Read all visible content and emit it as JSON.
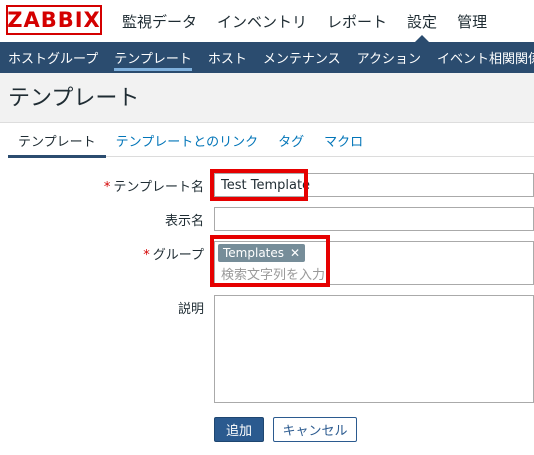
{
  "app": {
    "logo": "ZABBIX"
  },
  "topmenu": [
    "監視データ",
    "インベントリ",
    "レポート",
    "設定",
    "管理"
  ],
  "subnav": [
    "ホストグループ",
    "テンプレート",
    "ホスト",
    "メンテナンス",
    "アクション",
    "イベント相関関係"
  ],
  "page": {
    "title": "テンプレート"
  },
  "tabs": [
    "テンプレート",
    "テンプレートとのリンク",
    "タグ",
    "マクロ"
  ],
  "form": {
    "required_mark": "*",
    "template_name": {
      "label": "テンプレート名",
      "value": "Test Template"
    },
    "visible_name": {
      "label": "表示名",
      "value": ""
    },
    "groups": {
      "label": "グループ",
      "chip": "Templates",
      "placeholder": "検索文字列を入力"
    },
    "description": {
      "label": "説明",
      "value": ""
    }
  },
  "buttons": {
    "add": "追加",
    "cancel": "キャンセル"
  },
  "colors": {
    "brand": "#d40000",
    "nav": "#2b4c6f",
    "highlight": "#e60000"
  }
}
